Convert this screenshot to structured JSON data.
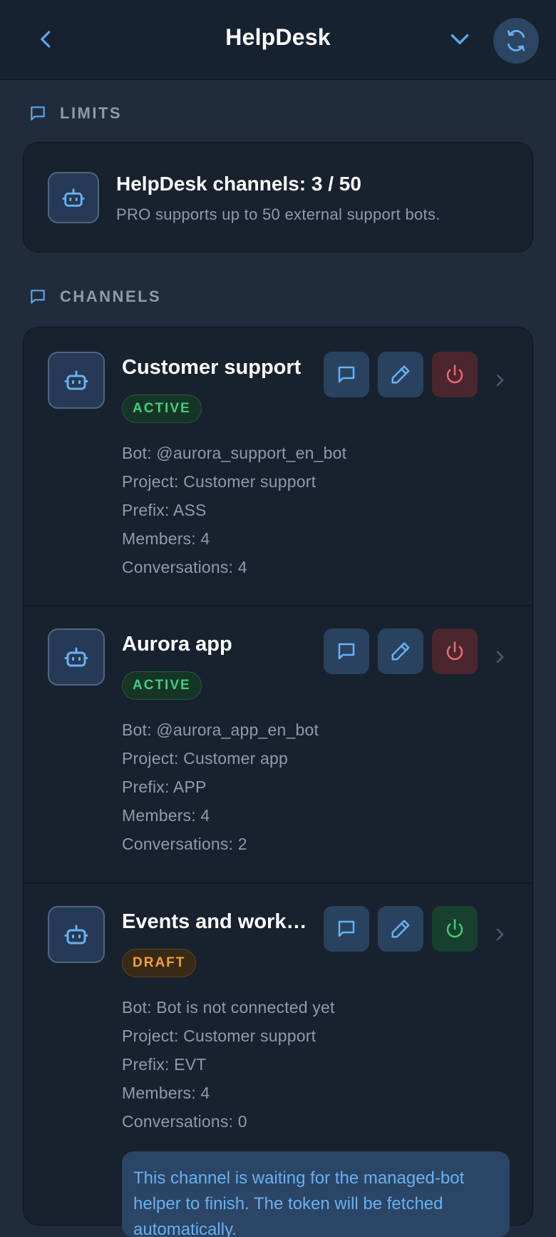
{
  "header": {
    "title": "HelpDesk",
    "back_icon": "chevron-left-icon",
    "dropdown_icon": "chevron-down-icon",
    "refresh_icon": "refresh-icon"
  },
  "limits": {
    "section_label": "LIMITS",
    "title": "HelpDesk channels: 3 / 50",
    "subtitle": "PRO supports up to 50 external support bots."
  },
  "channels_section": {
    "label": "CHANNELS"
  },
  "channels": [
    {
      "name": "Customer support",
      "status": "ACTIVE",
      "bot": "Bot: @aurora_support_en_bot",
      "project": "Project: Customer support",
      "prefix": "Prefix: ASS",
      "members": "Members: 4",
      "conversations": "Conversations: 4"
    },
    {
      "name": "Aurora app",
      "status": "ACTIVE",
      "bot": "Bot: @aurora_app_en_bot",
      "project": "Project: Customer app",
      "prefix": "Prefix: APP",
      "members": "Members: 4",
      "conversations": "Conversations: 2"
    },
    {
      "name": "Events and workshops",
      "status": "DRAFT",
      "bot": "Bot: Bot is not connected yet",
      "project": "Project: Customer support",
      "prefix": "Prefix: EVT",
      "members": "Members: 4",
      "conversations": "Conversations: 0",
      "notice": "This channel is waiting for the managed-bot helper to finish. The token will be fetched automatically."
    }
  ],
  "colors": {
    "background": "#202c3b",
    "card": "#18222e",
    "accent_blue": "#6ab0f0",
    "active_green": "#3fcf7a",
    "draft_orange": "#f4a22e",
    "power_red": "#f06a70"
  }
}
